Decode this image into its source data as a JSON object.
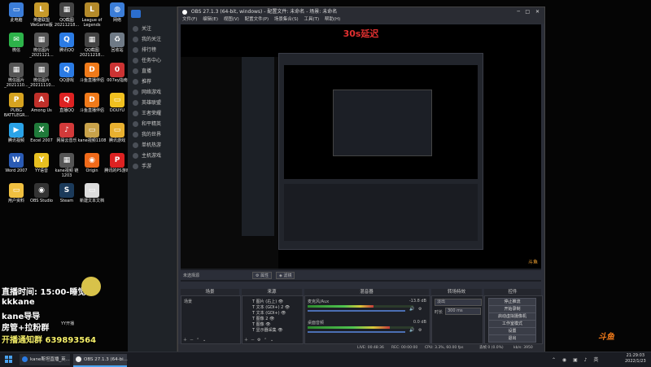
{
  "desktop": {
    "icons": [
      {
        "label": "此电脑",
        "color": "#3b7dd8",
        "glyph": "▭"
      },
      {
        "label": "英雄联盟WeGame版",
        "color": "#c79a2a",
        "glyph": "L"
      },
      {
        "label": "QQ截图20211218...",
        "color": "#444",
        "glyph": "▦"
      },
      {
        "label": "League of Legends",
        "color": "#b48a2a",
        "glyph": "L"
      },
      {
        "label": "网络",
        "color": "#3b7dd8",
        "glyph": "◍"
      },
      {
        "label": "微信",
        "color": "#2db34a",
        "glyph": "✉"
      },
      {
        "label": "微信图片_2021121...",
        "color": "#555",
        "glyph": "▦"
      },
      {
        "label": "腾讯QQ",
        "color": "#2b7be4",
        "glyph": "Q"
      },
      {
        "label": "QQ截图20211218...",
        "color": "#444",
        "glyph": "▦"
      },
      {
        "label": "回收站",
        "color": "#6f7a86",
        "glyph": "♻"
      },
      {
        "label": "微信图片_2021110...",
        "color": "#555",
        "glyph": "▦"
      },
      {
        "label": "微信图片_20211110...",
        "color": "#555",
        "glyph": "▦"
      },
      {
        "label": "QQ游戏",
        "color": "#2b7be4",
        "glyph": "Q"
      },
      {
        "label": "斗鱼直播伴侣",
        "color": "#f07a1a",
        "glyph": "D"
      },
      {
        "label": "007ey指南",
        "color": "#c33",
        "glyph": "0"
      },
      {
        "label": "PUBG BATTLEGR...",
        "color": "#d6a320",
        "glyph": "P"
      },
      {
        "label": "Among Us",
        "color": "#c0302a",
        "glyph": "A"
      },
      {
        "label": "直播QQ",
        "color": "#d22",
        "glyph": "Q"
      },
      {
        "label": "斗鱼直播伴侣",
        "color": "#f07a1a",
        "glyph": "D"
      },
      {
        "label": "DOUYU",
        "color": "#f0c020",
        "glyph": "▭"
      },
      {
        "label": "腾讯视频",
        "color": "#2aa3e8",
        "glyph": "▶"
      },
      {
        "label": "Excel 2007",
        "color": "#1f7a3a",
        "glyph": "X"
      },
      {
        "label": "网易云音乐",
        "color": "#d23a3a",
        "glyph": "♪"
      },
      {
        "label": "kane视频1108",
        "color": "#c8a24a",
        "glyph": "▭"
      },
      {
        "label": "腾讯游戏",
        "color": "#e8b030",
        "glyph": "▭"
      },
      {
        "label": "Word 2007",
        "color": "#2a5bb4",
        "glyph": "W"
      },
      {
        "label": "YY语音",
        "color": "#e8c020",
        "glyph": "Y"
      },
      {
        "label": "kane视频 链1203",
        "color": "#555",
        "glyph": "▦"
      },
      {
        "label": "Origin",
        "color": "#f06a1a",
        "glyph": "◉"
      },
      {
        "label": "腾讯的PS游戏",
        "color": "#d22",
        "glyph": "P"
      },
      {
        "label": "用户资料",
        "color": "#f0c040",
        "glyph": "▭"
      },
      {
        "label": "OBS Studio",
        "color": "#333",
        "glyph": "◉"
      },
      {
        "label": "Steam",
        "color": "#1b3a5a",
        "glyph": "S"
      },
      {
        "label": "新建文本文档",
        "color": "#ddd",
        "glyph": "▭"
      }
    ]
  },
  "browser": {
    "items": [
      "关注",
      "我的关注",
      "排行榜",
      "任务中心",
      "直播",
      "推荐",
      "网络游戏",
      "英雄联盟",
      "王者荣耀",
      "和平精英",
      "我的世界",
      "单机热游",
      "主机游戏",
      "手游"
    ]
  },
  "obs": {
    "title": "OBS 27.1.3 (64-bit, windows) - 配置文件: 未命名 - 场景: 未命名",
    "menu": [
      "文件(F)",
      "编辑(E)",
      "视图(V)",
      "配置文件(P)",
      "场景集合(S)",
      "工具(T)",
      "帮助(H)"
    ],
    "canvas_label": "30s延迟",
    "no_source": "未选择源",
    "properties_label": "属性",
    "filters_label": "滤镜",
    "scenes": {
      "title": "场景",
      "items": [
        "场景"
      ]
    },
    "sources": {
      "title": "来源",
      "items": [
        "图片 (右上)",
        "文本 (GDI+) 2",
        "文本 (GDI+)",
        "图像 2",
        "图像",
        "显示器采集"
      ]
    },
    "mixer": {
      "title": "混音器",
      "channels": [
        {
          "name": "麦克风/Aux",
          "db": "-13.8 dB",
          "level": 0.62
        },
        {
          "name": "桌面音频",
          "db": "0.0 dB",
          "level": 0.78
        }
      ]
    },
    "transitions": {
      "title": "转场特效",
      "type": "淡出",
      "duration_label": "时长",
      "duration": "300 ms"
    },
    "controls": {
      "title": "控件",
      "buttons": [
        "停止推流",
        "开始录制",
        "启动虚拟摄像机",
        "工作室模式",
        "设置",
        "退出"
      ]
    },
    "status": {
      "live": "LIVE: 00:48:36",
      "rec": "REC: 00:00:00",
      "cpu": "CPU: 3.3%, 60.00 fps",
      "dropped": "丢帧 0 (0.0%)",
      "kbps": "kb/s: 3950"
    }
  },
  "overlay": {
    "schedule": "直播时间: 15:00-睡觉",
    "name1": "kkkane",
    "name2": "kane导导",
    "fans": "房管+拉粉群",
    "notice": "开播通知群 639893564",
    "yy_label": "YY开播",
    "logo": "斗鱼"
  },
  "taskbar": {
    "items": [
      {
        "label": "kane斯坦直播_英..."
      },
      {
        "label": "OBS 27.1.3 (64-bi..."
      }
    ],
    "time": "21:29:03",
    "date": "2022/1/23"
  }
}
